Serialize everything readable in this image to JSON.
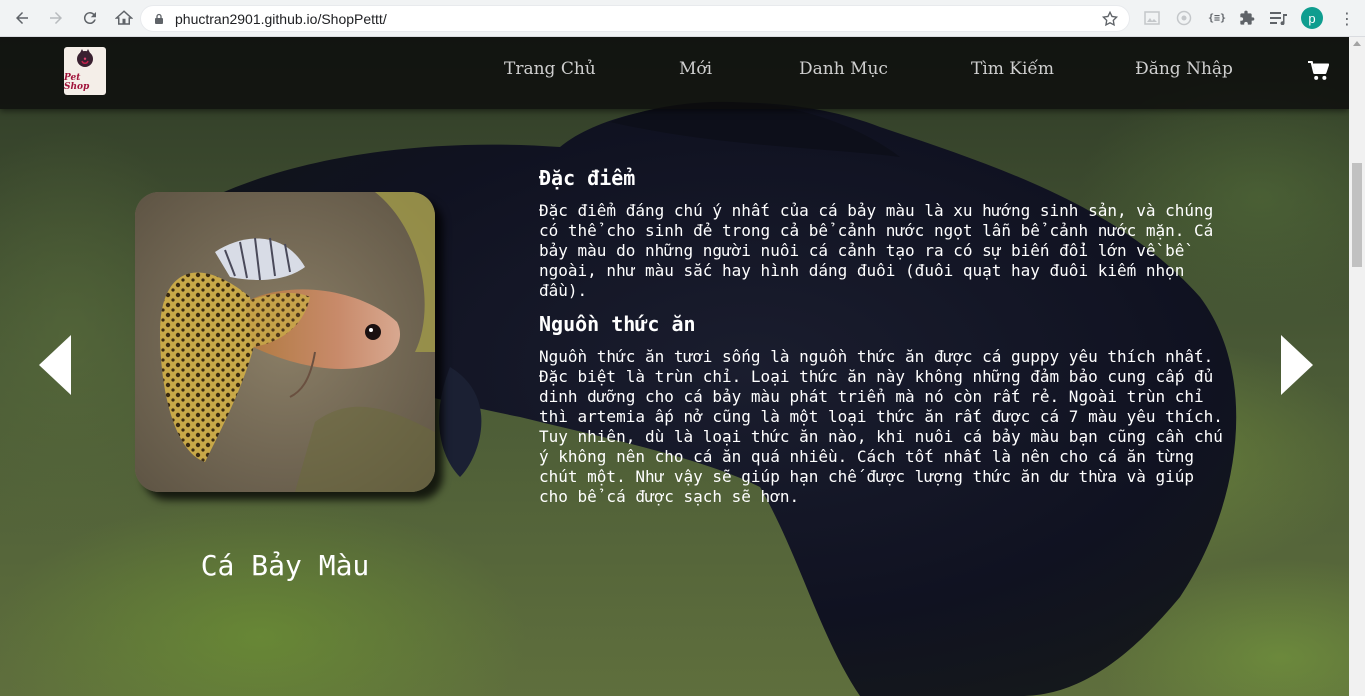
{
  "browser": {
    "url": "phuctran2901.github.io/ShopPettt/",
    "profile_initial": "p",
    "extensions": [
      "image-extension-icon",
      "circle-extension-icon",
      "json-extension-icon",
      "puzzle-icon",
      "playlist-icon"
    ],
    "json_ext_label": "{≡}"
  },
  "site": {
    "logo_text": "Pet Shop",
    "nav": [
      "Trang Chủ",
      "Mới",
      "Danh Mục",
      "Tìm Kiếm",
      "Đăng Nhập"
    ]
  },
  "product": {
    "name": "Cá Bảy Màu",
    "sections": [
      {
        "heading": "Đặc điểm",
        "body": "Đặc điểm đáng chú ý nhất của cá bảy màu là xu hướng sinh sản, và chúng có thể cho sinh đẻ trong cả bể cảnh nước ngọt lẫn bể cảnh nước mặn. Cá bảy màu do những người nuôi cá cảnh tạo ra có sự biến đổi lớn về bề ngoài, như màu sắc hay hình dáng đuôi (đuôi quạt hay đuôi kiếm nhọn đầu)."
      },
      {
        "heading": "Nguồn thức ăn",
        "body": "Nguồn thức ăn tươi sống là nguồn thức ăn được cá guppy yêu thích nhất. Đặc biệt là trùn chỉ. Loại thức ăn này không những đảm bảo cung cấp đủ dinh dưỡng cho cá bảy màu phát triển mà nó còn rất rẻ. Ngoài trùn chỉ thì artemia ấp nở cũng là một loại thức ăn rất được cá 7 màu yêu thích. Tuy nhiên, dù là loại thức ăn nào, khi nuôi cá bảy màu bạn cũng cần chú ý không nên cho cá ăn quá nhiều. Cách tốt nhất là nên cho cá ăn từng chút một. Như vậy sẽ giúp hạn chế được lượng thức ăn dư thừa và giúp cho bể cá được sạch sẽ hơn."
      }
    ]
  },
  "colors": {
    "header_bg": "#0c0c0c",
    "nav_text": "#cfcfcf",
    "text": "#ffffff",
    "profile": "#0f9d8f"
  }
}
